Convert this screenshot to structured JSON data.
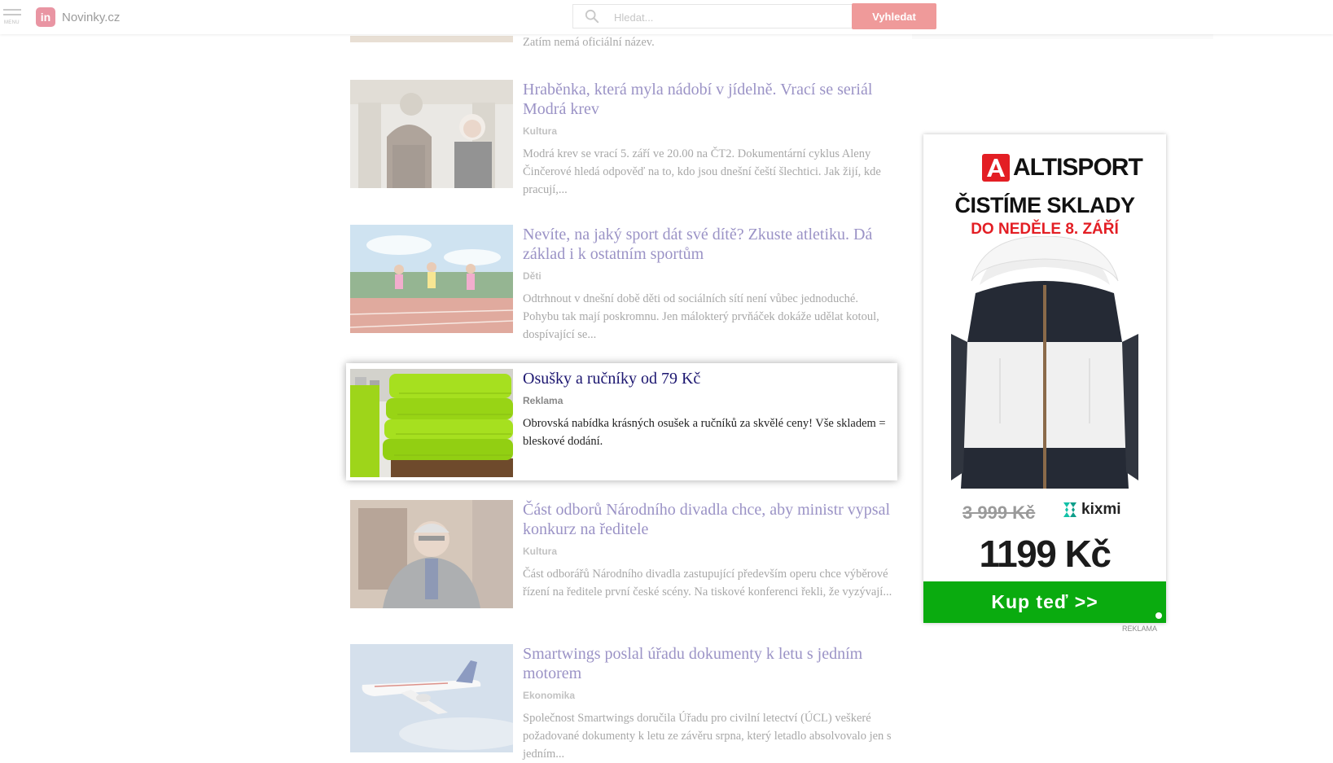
{
  "header": {
    "menu_label": "MENU",
    "logo_badge": "in",
    "logo_text": "Novinky.cz",
    "search_placeholder": "Hledat...",
    "search_button": "Vyhledat"
  },
  "top_snippet": "Zatím nemá oficiální název.",
  "articles": [
    {
      "title": "Hraběnka, která myla nádobí v jídelně. Vrací se seriál Modrá krev",
      "category": "Kultura",
      "perex": "Modrá krev se vrací 5. září ve 20.00 na ČT2. Dokumentární cyklus Aleny Činčerové hledá odpověď na to, kdo jsou dnešní čeští šlechtici. Jak žijí, kde pracují,..."
    },
    {
      "title": "Nevíte, na jaký sport dát své dítě? Zkuste atletiku. Dá základ i k ostatním sportům",
      "category": "Děti",
      "perex": "Odtrhnout v dnešní době děti od sociálních sítí není vůbec jednoduché. Pohybu tak mají poskromnu. Jen málokterý prvňáček dokáže udělat kotoul, dospívající se..."
    },
    {
      "title": "Osušky a ručníky od 79 Kč",
      "category": "Reklama",
      "perex": "Obrovská nabídka krásných osušek a ručníků za skvělé ceny! Vše skladem = bleskové dodání."
    },
    {
      "title": "Část odborů Národního divadla chce, aby ministr vypsal konkurz na ředitele",
      "category": "Kultura",
      "perex": "Část odborářů Národního divadla zastupující především operu chce výběrové řízení na ředitele první české scény. Na tiskové konferenci řekli, že vyzývají..."
    },
    {
      "title": "Smartwings poslal úřadu dokumenty k letu s jedním motorem",
      "category": "Ekonomika",
      "perex": "Společnost Smartwings doručila Úřadu pro civilní letectví (ÚCL) veškeré požadované dokumenty k letu ze závěru srpna, který letadlo absolvovalo jen s jedním..."
    }
  ],
  "banner": {
    "brand": "ALTISPORT",
    "headline": "ČISTÍME SKLADY",
    "subline": "DO NEDĚLE 8. ZÁŘÍ",
    "old_price": "3 999 Kč",
    "partner": "kixmi",
    "price": "1199 Kč",
    "cta": "Kup teď  >>",
    "ad_label": "REKLAMA",
    "colors": {
      "red": "#e31e24",
      "green": "#0aab0f"
    }
  }
}
